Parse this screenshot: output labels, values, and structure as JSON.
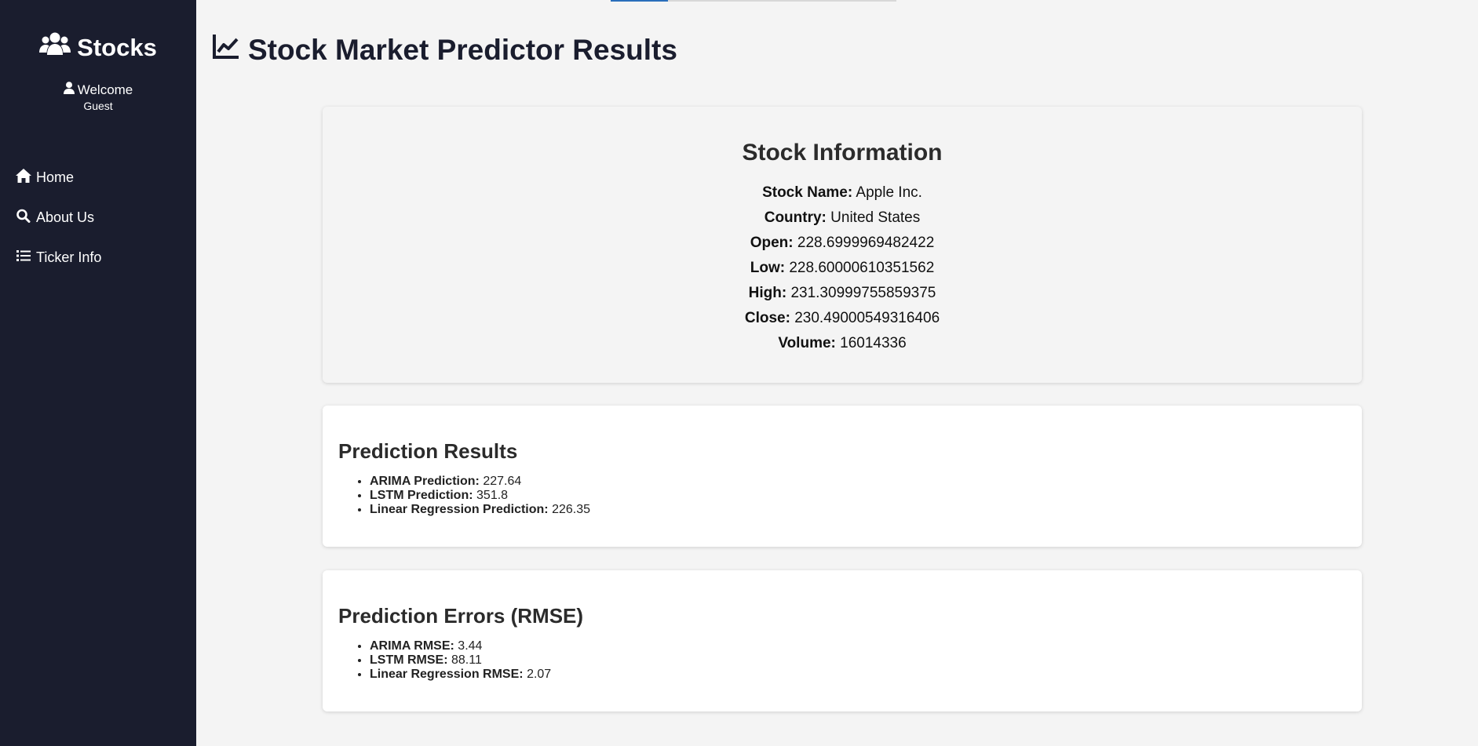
{
  "sidebar": {
    "brand": "Stocks",
    "welcome": "Welcome",
    "user": "Guest",
    "items": [
      {
        "label": "Home",
        "icon": "home-icon"
      },
      {
        "label": "About Us",
        "icon": "search-icon"
      },
      {
        "label": "Ticker Info",
        "icon": "list-icon"
      }
    ]
  },
  "header": {
    "title": "Stock Market Predictor Results"
  },
  "info": {
    "heading": "Stock Information",
    "rows": [
      {
        "label": "Stock Name:",
        "value": "Apple Inc."
      },
      {
        "label": "Country:",
        "value": "United States"
      },
      {
        "label": "Open:",
        "value": "228.6999969482422"
      },
      {
        "label": "Low:",
        "value": "228.60000610351562"
      },
      {
        "label": "High:",
        "value": "231.30999755859375"
      },
      {
        "label": "Close:",
        "value": "230.49000549316406"
      },
      {
        "label": "Volume:",
        "value": "16014336"
      }
    ]
  },
  "predictions": {
    "heading": "Prediction Results",
    "items": [
      {
        "label": "ARIMA Prediction:",
        "value": "227.64"
      },
      {
        "label": "LSTM Prediction:",
        "value": "351.8"
      },
      {
        "label": "Linear Regression Prediction:",
        "value": "226.35"
      }
    ]
  },
  "errors": {
    "heading": "Prediction Errors (RMSE)",
    "items": [
      {
        "label": "ARIMA RMSE:",
        "value": "3.44"
      },
      {
        "label": "LSTM RMSE:",
        "value": "88.11"
      },
      {
        "label": "Linear Regression RMSE:",
        "value": "2.07"
      }
    ]
  },
  "colors": {
    "sidebar": "#1a1d2e",
    "background": "#f4f4f4",
    "accent": "#2a6ebb"
  }
}
